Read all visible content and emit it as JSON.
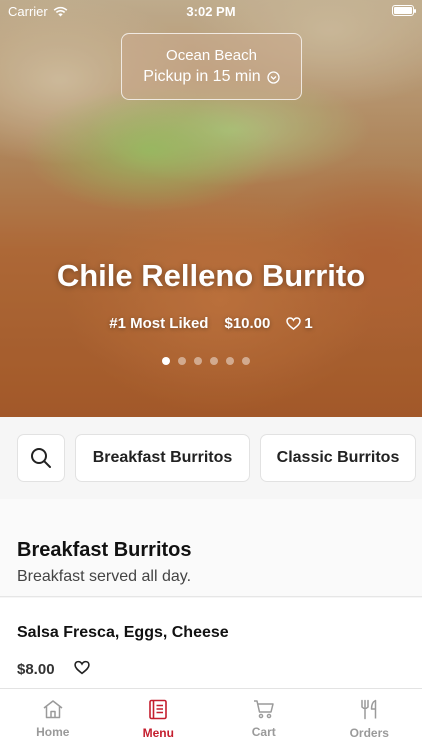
{
  "status_bar": {
    "carrier": "Carrier",
    "time": "3:02 PM"
  },
  "location": {
    "name": "Ocean Beach",
    "pickup": "Pickup in 15 min"
  },
  "hero": {
    "title": "Chile Relleno Burrito",
    "rank": "#1 Most Liked",
    "price": "$10.00",
    "likes": "1",
    "carousel_count": 6,
    "carousel_active": 0
  },
  "categories": {
    "items": [
      "Breakfast Burritos",
      "Classic Burritos"
    ]
  },
  "section": {
    "title": "Breakfast Burritos",
    "subtitle": "Breakfast served all day."
  },
  "item": {
    "name": "Salsa Fresca, Eggs, Cheese",
    "price": "$8.00"
  },
  "tabs": [
    {
      "label": "Home",
      "icon": "home-icon"
    },
    {
      "label": "Menu",
      "icon": "menu-icon"
    },
    {
      "label": "Cart",
      "icon": "cart-icon"
    },
    {
      "label": "Orders",
      "icon": "orders-icon"
    }
  ],
  "colors": {
    "accent": "#c41e2e",
    "inactive_tab": "#9a9a9a"
  }
}
